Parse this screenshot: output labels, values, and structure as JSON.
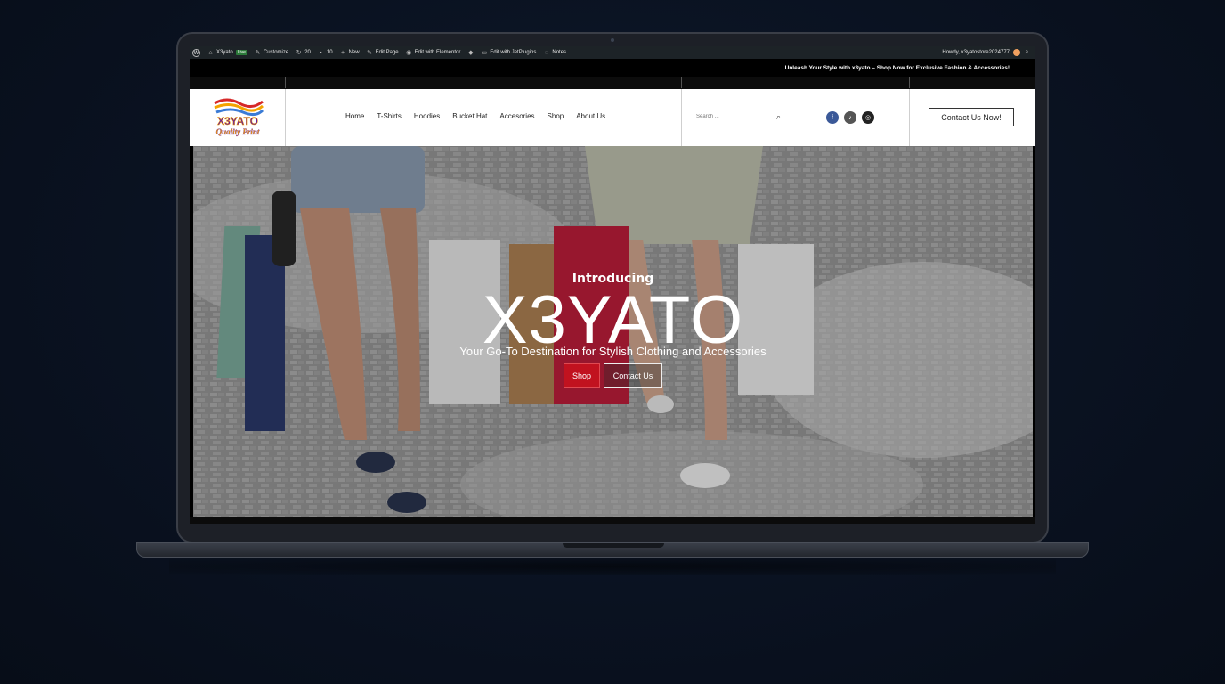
{
  "admin_bar": {
    "site_name": "X3yato",
    "live_badge": "Live",
    "customize": "Customize",
    "updates_count": "20",
    "comments_count": "10",
    "new": "New",
    "edit_page": "Edit Page",
    "edit_elementor": "Edit with Elementor",
    "edit_jetplugins": "Edit with JetPlugins",
    "notes": "Notes",
    "howdy": "Howdy, x3yatostore2024777"
  },
  "announcement": "Unleash Your Style with x3yato – Shop Now for Exclusive Fashion & Accessories!",
  "logo": {
    "line1": "X3YATO",
    "line2": "Quality Print"
  },
  "nav": {
    "items": [
      {
        "label": "Home"
      },
      {
        "label": "T-Shirts"
      },
      {
        "label": "Hoodies"
      },
      {
        "label": "Bucket Hat"
      },
      {
        "label": "Accesories"
      },
      {
        "label": "Shop"
      },
      {
        "label": "About Us"
      }
    ]
  },
  "search": {
    "placeholder": "Search ..."
  },
  "social": [
    {
      "icon": "facebook-icon",
      "color": "#3b5998"
    },
    {
      "icon": "tiktok-icon",
      "color": "#555555"
    },
    {
      "icon": "instagram-icon",
      "color": "#222222"
    }
  ],
  "header_cta": "Contact Us Now!",
  "hero": {
    "kicker": "Introducing",
    "title": "X3YATO",
    "subtitle": "Your Go-To Destination for Stylish Clothing and Accessories",
    "primary_button": "Shop",
    "secondary_button": "Contact Us"
  },
  "colors": {
    "accent_red": "#c1121f",
    "admin_bar": "#1d2327",
    "background": "#0a1221"
  }
}
